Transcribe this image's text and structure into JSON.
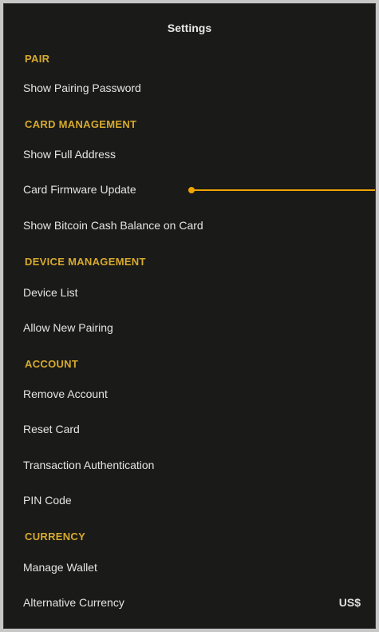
{
  "header": {
    "title": "Settings"
  },
  "sections": {
    "pair": {
      "title": "PAIR",
      "items": [
        "Show Pairing Password"
      ]
    },
    "card_management": {
      "title": "CARD MANAGEMENT",
      "items": [
        "Show Full Address",
        "Card Firmware Update",
        "Show Bitcoin Cash Balance on Card"
      ]
    },
    "device_management": {
      "title": "DEVICE MANAGEMENT",
      "items": [
        "Device List",
        "Allow New Pairing"
      ]
    },
    "account": {
      "title": "ACCOUNT",
      "items": [
        "Remove Account",
        "Reset Card",
        "Transaction Authentication",
        "PIN Code"
      ]
    },
    "currency": {
      "title": "CURRENCY",
      "items": [
        "Manage Wallet",
        "Alternative Currency"
      ],
      "alternative_currency_value": "US$"
    }
  },
  "colors": {
    "background": "#1a1a18",
    "section_header": "#d6aa2e",
    "item_text": "#e4e4e4",
    "callout": "#f0a500"
  }
}
